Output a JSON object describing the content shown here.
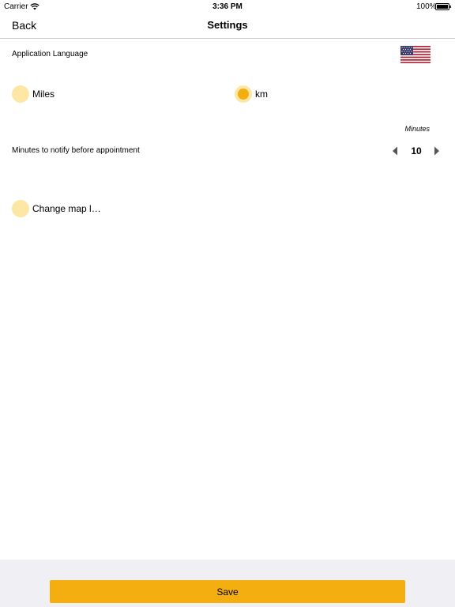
{
  "status_bar": {
    "carrier": "Carrier",
    "time": "3:36 PM",
    "battery": "100%"
  },
  "nav": {
    "back_label": "Back",
    "title": "Settings"
  },
  "language": {
    "label": "Application Language",
    "flag_icon": "us-flag-icon"
  },
  "distance_units": {
    "options": [
      {
        "label": "Miles",
        "selected": false
      },
      {
        "label": "km",
        "selected": true
      }
    ]
  },
  "notify": {
    "caption": "Minutes",
    "label": "Minutes to notify before appointment",
    "value": "10"
  },
  "map": {
    "label": "Change map l…",
    "selected": false
  },
  "save_label": "Save",
  "colors": {
    "accent": "#f5ae10",
    "radio_bg": "#fde7a4",
    "bottom_bg": "#efeff4"
  }
}
